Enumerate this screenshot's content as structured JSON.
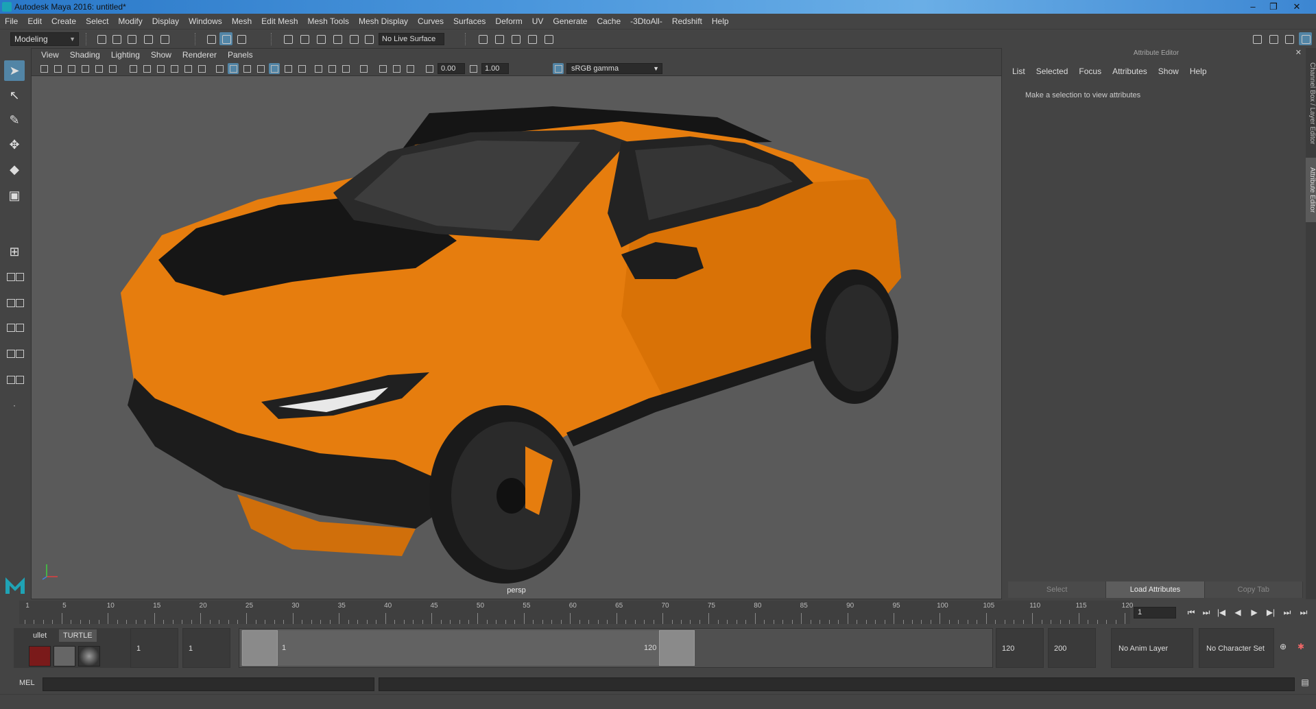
{
  "window": {
    "title": "Autodesk Maya 2016: untitled*",
    "minimize": "–",
    "restore": "❐",
    "close": "✕"
  },
  "menubar": [
    "File",
    "Edit",
    "Create",
    "Select",
    "Modify",
    "Display",
    "Windows",
    "Mesh",
    "Edit Mesh",
    "Mesh Tools",
    "Mesh Display",
    "Curves",
    "Surfaces",
    "Deform",
    "UV",
    "Generate",
    "Cache",
    "-3DtoAll-",
    "Redshift",
    "Help"
  ],
  "shelfbar": {
    "mode": "Modeling",
    "live_surface": "No Live Surface"
  },
  "viewport": {
    "menus": [
      "View",
      "Shading",
      "Lighting",
      "Show",
      "Renderer",
      "Panels"
    ],
    "exposure": "0.00",
    "gamma": "1.00",
    "color_management": "sRGB gamma",
    "camera": "persp"
  },
  "attribute_editor": {
    "title": "Attribute Editor",
    "menus": [
      "List",
      "Selected",
      "Focus",
      "Attributes",
      "Show",
      "Help"
    ],
    "message": "Make a selection to view attributes",
    "buttons": [
      "Select",
      "Load Attributes",
      "Copy Tab"
    ]
  },
  "side_tabs": [
    "Channel Box / Layer Editor",
    "Attribute Editor"
  ],
  "timeline": {
    "start": 1,
    "end": 120,
    "labels": [
      "1",
      "5",
      "10",
      "15",
      "20",
      "25",
      "30",
      "35",
      "40",
      "45",
      "50",
      "55",
      "60",
      "65",
      "70",
      "75",
      "80",
      "85",
      "90",
      "95",
      "100",
      "105",
      "110",
      "115",
      "120"
    ],
    "current_frame": "1"
  },
  "range": {
    "shelf_tabs": [
      "ullet",
      "TURTLE"
    ],
    "start_field": "1",
    "playback_start": "1",
    "slider_start": "1",
    "slider_end": "120",
    "playback_end": "120",
    "end_field": "200",
    "anim_layer": "No Anim Layer",
    "character_set": "No Character Set"
  },
  "command_line": {
    "label": "MEL"
  },
  "colors": {
    "accent": "#5285a6",
    "car_body": "#e67d0e",
    "viewport_bg": "#5a5a5a"
  }
}
